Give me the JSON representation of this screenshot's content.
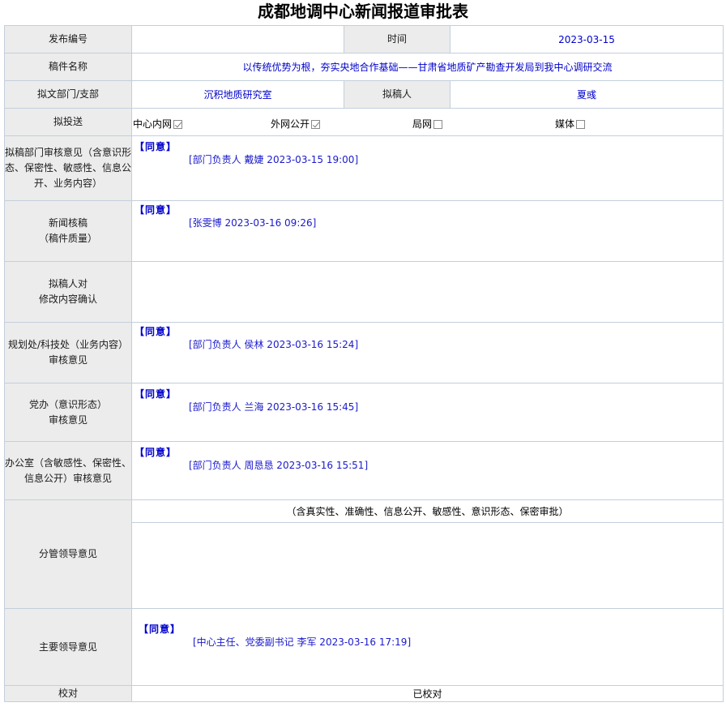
{
  "page": {
    "title": "成都地调中心新闻报道审批表"
  },
  "rows": {
    "number_label": "发布编号",
    "number_value": "",
    "time_label": "时间",
    "time_value": "2023-03-15",
    "manuscript_label": "稿件名称",
    "manuscript_value": "以传统优势为根，夯实央地合作基础——甘肃省地质矿产勘查开发局到我中心调研交流",
    "dept_label": "拟文部门/支部",
    "dept_value": "沉积地质研究室",
    "drafter_label": "拟稿人",
    "drafter_value": "夏彧",
    "distribution_label": "拟投送",
    "distribution_options": [
      {
        "label": "中心内网",
        "checked": true
      },
      {
        "label": "外网公开",
        "checked": true
      },
      {
        "label": "局网",
        "checked": false
      },
      {
        "label": "媒体",
        "checked": false
      }
    ]
  },
  "opinions": {
    "dept_review": {
      "label": "拟稿部门审核意见（含意识形态、保密性、敏感性、信息公开、业务内容）",
      "agree": "【同意】",
      "sign": "[部门负责人 戴婕 2023-03-15 19:00]"
    },
    "news_review": {
      "label_line1": "新闻核稿",
      "label_line2": "（稿件质量）",
      "agree": "【同意】",
      "sign": "[张雯博 2023-03-16 09:26]"
    },
    "drafter_confirm": {
      "label_line1": "拟稿人对",
      "label_line2": "修改内容确认"
    },
    "planning_review": {
      "label_line1": "规划处/科技处（业务内容）",
      "label_line2": "审核意见",
      "agree": "【同意】",
      "sign": "[部门负责人 侯林 2023-03-16 15:24]"
    },
    "party_review": {
      "label_line1": "党办（意识形态）",
      "label_line2": "审核意见",
      "agree": "【同意】",
      "sign": "[部门负责人 兰海 2023-03-16 15:45]"
    },
    "office_review": {
      "label": "办公室（含敏感性、保密性、信息公开）审核意见",
      "agree": "【同意】",
      "sign": "[部门负责人 周恳恳 2023-03-16 15:51]"
    },
    "leader_in_charge": {
      "label": "分管领导意见",
      "note": "（含真实性、准确性、信息公开、敏感性、意识形态、保密审批）"
    },
    "main_leader": {
      "label": "主要领导意见",
      "agree": "【同意】",
      "sign": "[中心主任、党委副书记 李军 2023-03-16 17:19]"
    },
    "proofread": {
      "label": "校对",
      "value": "已校对"
    }
  }
}
